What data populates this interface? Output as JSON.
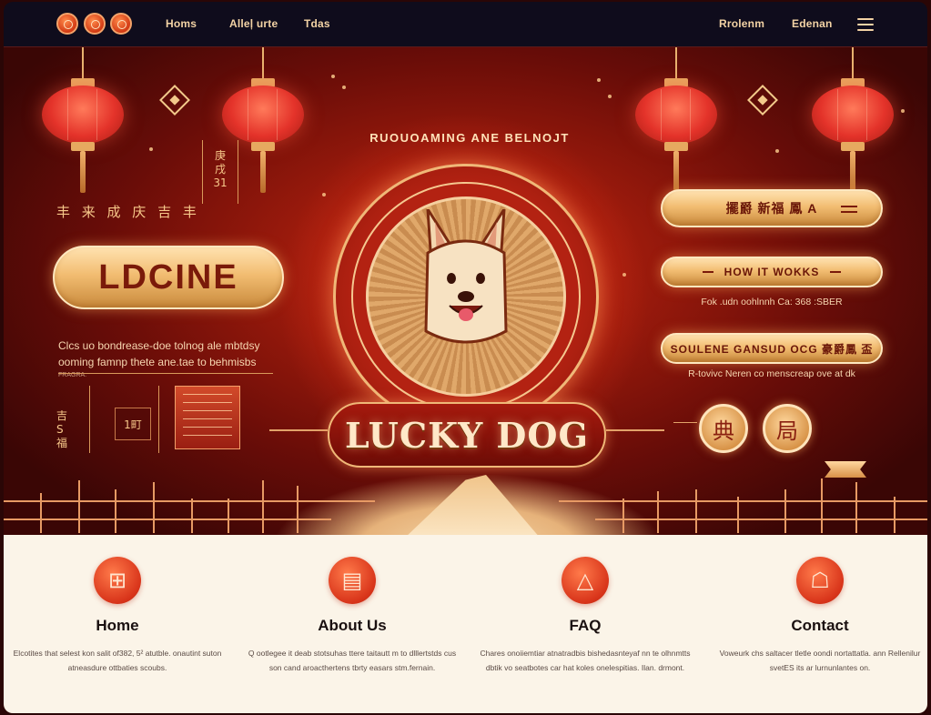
{
  "colors": {
    "accent": "#d8341a",
    "gold": "#f2bd72",
    "nav_bg": "#0f0c1c",
    "hero_red": "#9a1a0c",
    "features_bg": "#fbf4e8"
  },
  "nav": {
    "links": [
      "Homs",
      "Alleļ urte",
      "Tdas"
    ],
    "right_links": [
      "Rrolenm",
      "Edenan"
    ],
    "icons": [
      "circle-logo-icon",
      "circle-logo-icon",
      "circle-logo-icon",
      "hamburger-menu-icon"
    ]
  },
  "hero": {
    "arc_text": "RUOUOAMING ANE BELNOJT",
    "left_cjk": "丰 来 成 庆 吉 丰",
    "vertical_cjk": [
      "庚",
      "戌",
      "31"
    ],
    "big_button": "LDCINE",
    "left_text_line1": "Clcs uo  bondrease-doe tolnog ale mbtdsy",
    "left_text_line2": "ooming famnp thete ane.tae to behmisbs",
    "left_text_small": "FRAGRA.",
    "mini_glyphs": [
      "吉",
      "S",
      "福"
    ],
    "mini_box_label": "1町",
    "lucky_banner": "LUCKY DOG",
    "right_buttons": [
      {
        "label": "擺爵 新福 鳳 A",
        "sub": ""
      },
      {
        "label": "HOW IT WOKKS",
        "sub": "Fok .udn oohlnnh Ca: 368 :SBER"
      },
      {
        "label": "SOULENE GANSUD OCG 豪爵鳳 盃",
        "sub": "R-tovivc Neren co menscreap ove at dk"
      }
    ],
    "round_icons": [
      "典",
      "局"
    ]
  },
  "features": [
    {
      "icon": "window-icon",
      "glyph": "⊞",
      "title": "Home",
      "desc": "Elcotites that selest kon salit of382, 5² atutble. onautint suton atneasdure ottbaties scoubs."
    },
    {
      "icon": "document-icon",
      "glyph": "▤",
      "title": "About Us",
      "desc": "Q ootlegee it deab stotsuhas ttere taitautt m to dlllertstds cus son cand aroacthertens tbrty easars stm.fernain."
    },
    {
      "icon": "triangle-icon",
      "glyph": "△",
      "title": "FAQ",
      "desc": "Chares onoiiemtiar atnatradbis bishedasnteyaf nn te olhnmtts dbtik vo seatbotes car hat koles onelespitias. Ilan. drmont."
    },
    {
      "icon": "contact-icon",
      "glyph": "☖",
      "title": "Contact",
      "desc": "Voweurk chs saltacer tletle oondi nortattatla. ann Rellenilur svetES its ar lurnunlantes on."
    }
  ]
}
